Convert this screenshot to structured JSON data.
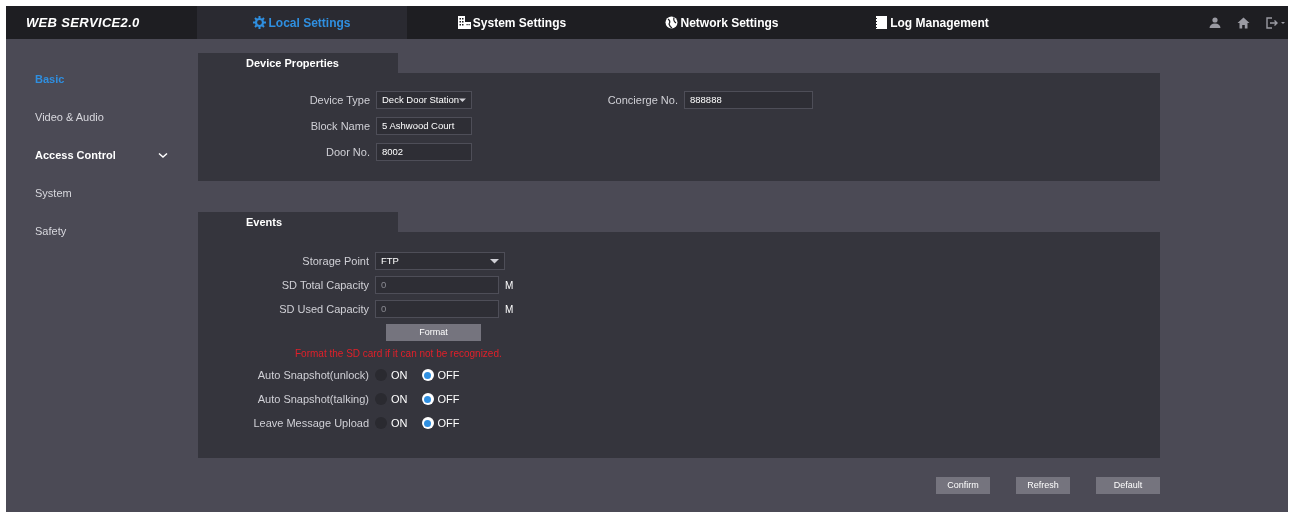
{
  "header": {
    "logo": "WEB SERVICE2.0",
    "tabs": [
      {
        "label": "Local Settings",
        "selected": true
      },
      {
        "label": "System Settings",
        "selected": false
      },
      {
        "label": "Network Settings",
        "selected": false
      },
      {
        "label": "Log Management",
        "selected": false
      }
    ]
  },
  "sidebar": {
    "items": [
      {
        "label": "Basic",
        "selected": true,
        "kind": "item"
      },
      {
        "label": "Video & Audio",
        "selected": false,
        "kind": "item"
      },
      {
        "label": "Access Control",
        "selected": false,
        "kind": "group"
      },
      {
        "label": "System",
        "selected": false,
        "kind": "item"
      },
      {
        "label": "Safety",
        "selected": false,
        "kind": "item"
      }
    ]
  },
  "device_properties": {
    "title": "Device Properties",
    "left_fields": [
      {
        "label": "Device Type",
        "value": "Deck Door Station",
        "kind": "select"
      },
      {
        "label": "Block Name",
        "value": "5 Ashwood Court",
        "kind": "text"
      },
      {
        "label": "Door No.",
        "value": "8002",
        "kind": "text"
      }
    ],
    "right_fields": [
      {
        "label": "Concierge No.",
        "value": "888888",
        "kind": "text"
      }
    ]
  },
  "events": {
    "title": "Events",
    "storage_point": {
      "label": "Storage Point",
      "value": "FTP"
    },
    "capacities": [
      {
        "label": "SD Total Capacity",
        "value": "0",
        "unit": "M"
      },
      {
        "label": "SD Used Capacity",
        "value": "0",
        "unit": "M"
      }
    ],
    "format_button": "Format",
    "warning": "Format the SD card if it can not be recognized.",
    "radio_groups": [
      {
        "label": "Auto Snapshot(unlock)",
        "options": [
          {
            "label": "ON",
            "selected": false
          },
          {
            "label": "OFF",
            "selected": true
          }
        ]
      },
      {
        "label": "Auto Snapshot(talking)",
        "options": [
          {
            "label": "ON",
            "selected": false
          },
          {
            "label": "OFF",
            "selected": true
          }
        ]
      },
      {
        "label": "Leave Message Upload",
        "options": [
          {
            "label": "ON",
            "selected": false
          },
          {
            "label": "OFF",
            "selected": true
          }
        ]
      }
    ]
  },
  "buttons": [
    "Confirm",
    "Refresh",
    "Default"
  ]
}
